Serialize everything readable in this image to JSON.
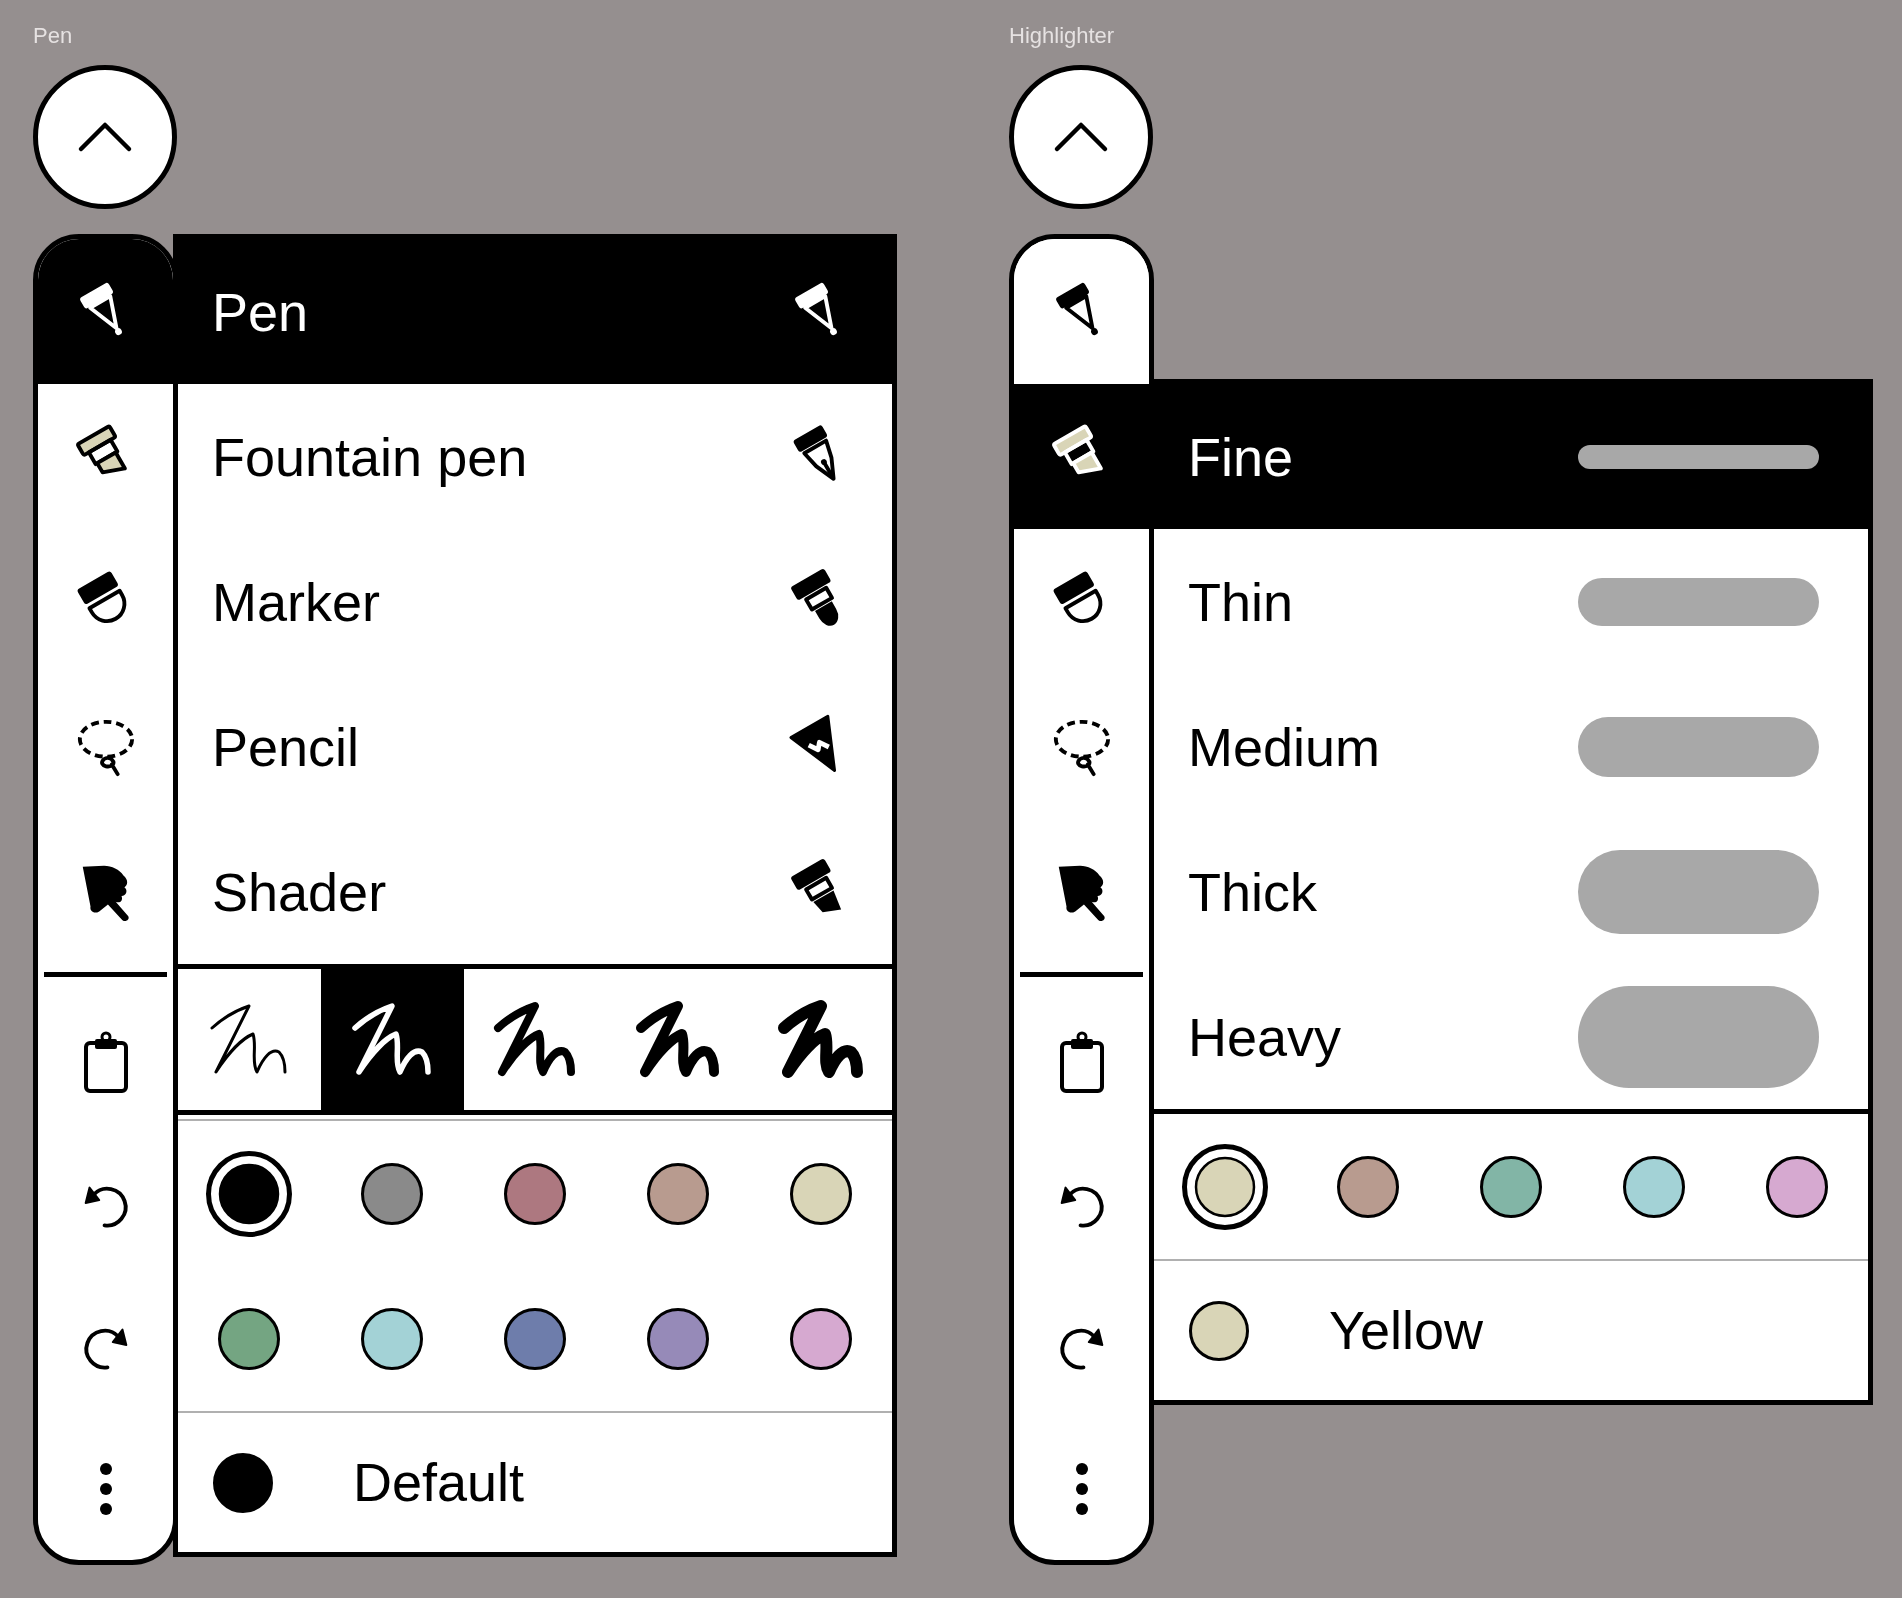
{
  "panels": [
    {
      "kind": "types",
      "caption": "Pen",
      "tools": [
        {
          "selected": true
        },
        {
          "selected": false
        },
        {
          "selected": false
        },
        {
          "selected": false
        },
        {
          "selected": false
        }
      ],
      "options": [
        {
          "label": "Pen",
          "selected": true
        },
        {
          "label": "Fountain pen",
          "selected": false
        },
        {
          "label": "Marker",
          "selected": false
        },
        {
          "label": "Pencil",
          "selected": false
        },
        {
          "label": "Shader",
          "selected": false
        }
      ],
      "strokes": [
        {
          "selected": false
        },
        {
          "selected": true
        },
        {
          "selected": false
        },
        {
          "selected": false
        },
        {
          "selected": false
        }
      ],
      "colors": [
        {
          "color": "#000000",
          "selected": true
        },
        {
          "color": "#8a8a8a",
          "selected": false
        },
        {
          "color": "#ad7880",
          "selected": false
        },
        {
          "color": "#b89b8f",
          "selected": false
        },
        {
          "color": "#d9d5b7",
          "selected": false
        },
        {
          "color": "#74a582",
          "selected": false
        },
        {
          "color": "#a3d2d6",
          "selected": false
        },
        {
          "color": "#6e7dab",
          "selected": false
        },
        {
          "color": "#968ab8",
          "selected": false
        },
        {
          "color": "#d6a9d0",
          "selected": false
        }
      ],
      "current_color": {
        "color": "#000000",
        "label": "Default"
      }
    },
    {
      "kind": "widths",
      "caption": "Highlighter",
      "tools": [
        {
          "selected": false
        },
        {
          "selected": true
        },
        {
          "selected": false
        },
        {
          "selected": false
        },
        {
          "selected": false
        }
      ],
      "options": [
        {
          "label": "Fine",
          "selected": true
        },
        {
          "label": "Thin",
          "selected": false
        },
        {
          "label": "Medium",
          "selected": false
        },
        {
          "label": "Thick",
          "selected": false
        },
        {
          "label": "Heavy",
          "selected": false
        }
      ],
      "colors": [
        {
          "color": "#d9d5b7",
          "selected": true
        },
        {
          "color": "#b89b8f",
          "selected": false
        },
        {
          "color": "#82b5a6",
          "selected": false
        },
        {
          "color": "#a3d2d6",
          "selected": false
        },
        {
          "color": "#d6a9d0",
          "selected": false
        }
      ],
      "current_color": {
        "color": "#d9d5b7",
        "label": "Yellow"
      }
    }
  ]
}
